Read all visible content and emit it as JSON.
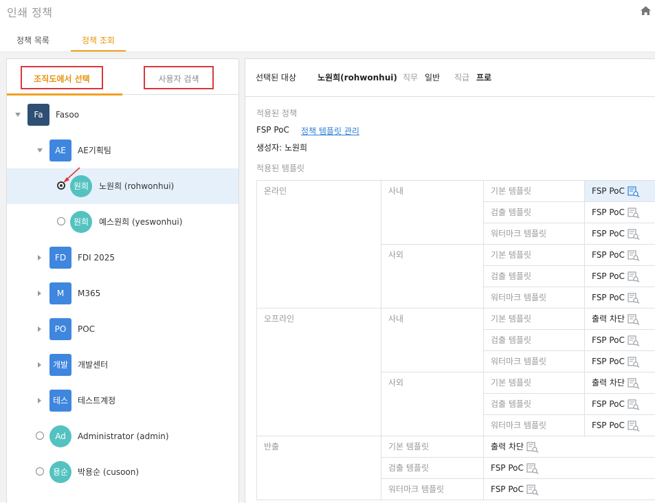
{
  "header": {
    "title": "인쇄 정책"
  },
  "tabs": [
    {
      "label": "정책 목록"
    },
    {
      "label": "정책 조회"
    }
  ],
  "left": {
    "tabs": [
      {
        "label": "조직도에서 선택"
      },
      {
        "label": "사용자 검색"
      }
    ],
    "tree": [
      {
        "avatar": "Fa",
        "label": "Fasoo"
      },
      {
        "avatar": "AE",
        "label": "AE기획팀"
      },
      {
        "avatar": "원희",
        "label": "노원희 (rohwonhui)"
      },
      {
        "avatar": "원희",
        "label": "예스원희 (yeswonhui)"
      },
      {
        "avatar": "FD",
        "label": "FDI 2025"
      },
      {
        "avatar": "M",
        "label": "M365"
      },
      {
        "avatar": "PO",
        "label": "POC"
      },
      {
        "avatar": "개발",
        "label": "개발센터"
      },
      {
        "avatar": "테스",
        "label": "테스트계정"
      },
      {
        "avatar": "Ad",
        "label": "Administrator (admin)"
      },
      {
        "avatar": "용순",
        "label": "박용순 (cusoon)"
      }
    ]
  },
  "right": {
    "selected_label": "선택된 대상",
    "selected_name": "노원희(rohwonhui)",
    "duty_label": "직무",
    "duty_value": "일반",
    "rank_label": "직급",
    "rank_value": "프로",
    "applied_policy_label": "적용된 정책",
    "policy_name": "FSP PoC",
    "template_link": "정책 템플릿 관리",
    "creator": "생성자: 노원희",
    "applied_template_label": "적용된 템플릿",
    "table": {
      "online": "온라인",
      "offline": "오프라인",
      "export": "반출",
      "internal": "사내",
      "external": "사외",
      "basic": "기본 템플릿",
      "detect": "검출 템플릿",
      "watermark": "워터마크 템플릿",
      "v_poc": "FSP PoC",
      "v_block": "출력 차단"
    }
  }
}
